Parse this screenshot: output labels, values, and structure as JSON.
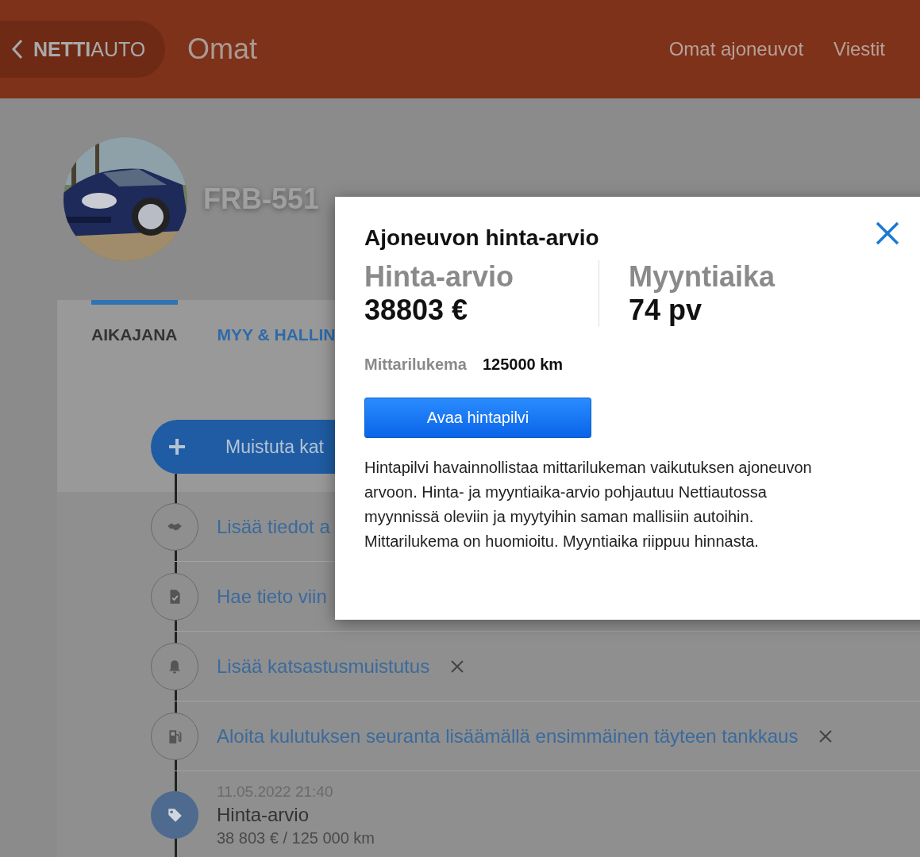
{
  "header": {
    "logo": "**NETTI**AUTO",
    "title": "Omat",
    "nav": [
      "Omat ajoneuvot",
      "Viestit"
    ]
  },
  "vehicle": {
    "plate": "FRB-551"
  },
  "tabs": [
    {
      "label": "AIKAJANA",
      "selected": true
    },
    {
      "label": "MYY & HALLIN",
      "selected": false
    }
  ],
  "add_button": {
    "label": "Muistuta kat"
  },
  "timeline": [
    {
      "kind": "task",
      "text": "Lisää tiedot a"
    },
    {
      "kind": "task",
      "text": "Hae tieto viin"
    },
    {
      "kind": "task",
      "text": "Lisää katsastusmuistutus",
      "dismissible": true
    },
    {
      "kind": "task",
      "text": "Aloita kulutuksen seuranta lisäämällä ensimmäinen täyteen tankkaus",
      "dismissible": true
    },
    {
      "kind": "event",
      "date": "11.05.2022 21:40",
      "title": "Hinta-arvio",
      "detail": "38 803 € / 125 000 km"
    }
  ],
  "modal": {
    "title": "Ajoneuvon hinta-arvio",
    "stats": [
      {
        "label": "Hinta-arvio",
        "value": "38803 €"
      },
      {
        "label": "Myyntiaika",
        "value": "74 pv"
      }
    ],
    "odometer": {
      "label": "Mittarilukema",
      "value": "125000 km"
    },
    "button": "Avaa hintapilvi",
    "description": "Hintapilvi havainnollistaa mittarilukeman vaikutuksen ajoneuvon arvoon. Hinta- ja myyntiaika-arvio pohjautuu Nettiautossa myynnissä oleviin ja myytyihin saman mallisiin autoihin. Mittarilukema on huomioitu. Myyntiaika riippuu hinnasta."
  }
}
